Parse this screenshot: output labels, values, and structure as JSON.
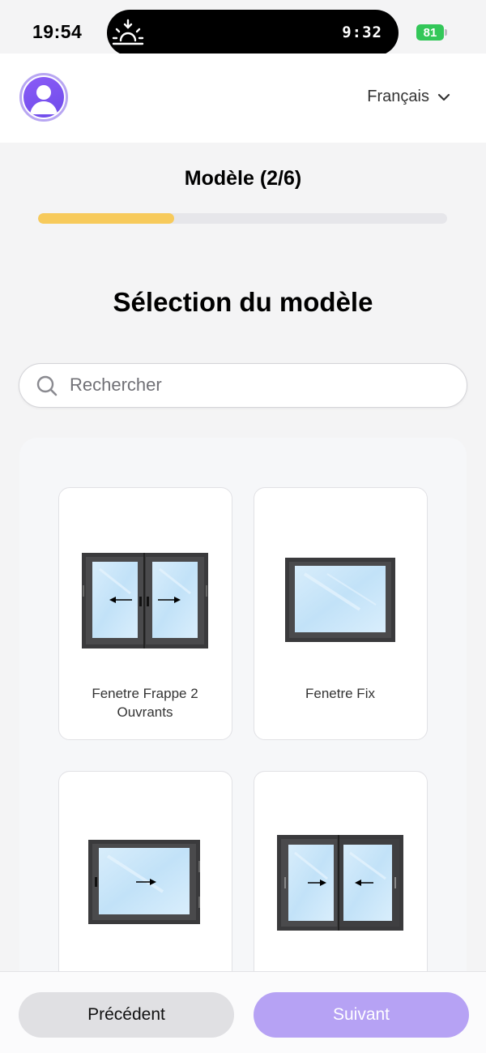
{
  "status_bar": {
    "time": "19:54",
    "island_time": "9:32",
    "battery": "81",
    "battery_color": "#33c759",
    "island_icon": "sunrise-icon"
  },
  "header": {
    "avatar_icon": "user-avatar-icon",
    "language": "Français",
    "language_icon": "chevron-down-icon"
  },
  "progress": {
    "step_title": "Modèle (2/6)",
    "fraction": 0.333,
    "fill_color": "#f7ca5b"
  },
  "main": {
    "title": "Sélection du modèle"
  },
  "search": {
    "placeholder": "Rechercher",
    "value": "",
    "icon": "search-icon"
  },
  "models": [
    {
      "label": "Fenetre Frappe 2 Ouvrants",
      "icon": "window-casement-2-sash-icon"
    },
    {
      "label": "Fenetre Fix",
      "icon": "window-fixed-icon"
    },
    {
      "label": "",
      "icon": "window-casement-1-sash-icon"
    },
    {
      "label": "",
      "icon": "window-sliding-2-panel-icon"
    }
  ],
  "footer": {
    "prev_label": "Précédent",
    "next_label": "Suivant",
    "accent_color": "#b6a2f4"
  }
}
